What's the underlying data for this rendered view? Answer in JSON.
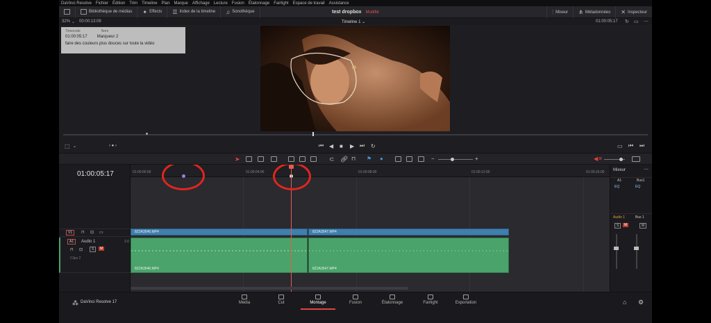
{
  "menu": [
    "DaVinci Resolve",
    "Fichier",
    "Édition",
    "Trim",
    "Timeline",
    "Plan",
    "Marque",
    "Affichage",
    "Lecture",
    "Fusion",
    "Étalonnage",
    "Fairlight",
    "Espace de travail",
    "Assistance"
  ],
  "toolbar": {
    "media_library": "Bibliothèque de médias",
    "effects": "Effects",
    "timeline_index": "Index de la timeline",
    "sound_library": "Sonothèque",
    "project_name": "test dropbox",
    "project_status": "Modifié",
    "mixer": "Mixeur",
    "metadata": "Métadonnées",
    "inspector": "Inspecteur"
  },
  "viewer": {
    "zoom": "32%",
    "source_timecode": "00:00:13:09",
    "timeline_name": "Timeline 1",
    "timecode": "01:00:05:17"
  },
  "marker_popup": {
    "col1_header": "Timecode",
    "col2_header": "Nom",
    "timecode": "01:00:05:17",
    "name": "Marqueur 2",
    "note": "faire des couleurs plus douces sur toute la vidéo"
  },
  "timeline": {
    "current_timecode": "01:00:05:17",
    "ruler_labels": [
      "01:00:00:00",
      "01:00:04:00",
      "01:00:08:00",
      "01:00:12:00",
      "01:00:16:00"
    ],
    "video_track": "V1",
    "audio_track": "A1",
    "audio_track_name": "Audio 1",
    "audio_channels": "2.0",
    "audio_clips_count": "Clips 2",
    "clip1_name": "8Z2A3546.MP4",
    "clip2_name": "8Z2A3547.MP4",
    "solo": "S",
    "mute": "M"
  },
  "mixer": {
    "title": "Mixeur",
    "ch1": "A1",
    "ch2": "Bus1",
    "ch1_label": "Audio 1",
    "ch2_label": "Bus 1",
    "solo": "S",
    "mute": "M",
    "eq": "EQ"
  },
  "pages": {
    "app_name": "DaVinci Resolve 17",
    "media": "Média",
    "cut": "Cut",
    "edit": "Montage",
    "fusion": "Fusion",
    "color": "Étalonnage",
    "fairlight": "Fairlight",
    "deliver": "Exportation"
  },
  "colors": {
    "accent": "#e0443a",
    "video_clip": "#3f7fae",
    "audio_clip": "#4aa36a",
    "annotation": "#e0261e"
  }
}
